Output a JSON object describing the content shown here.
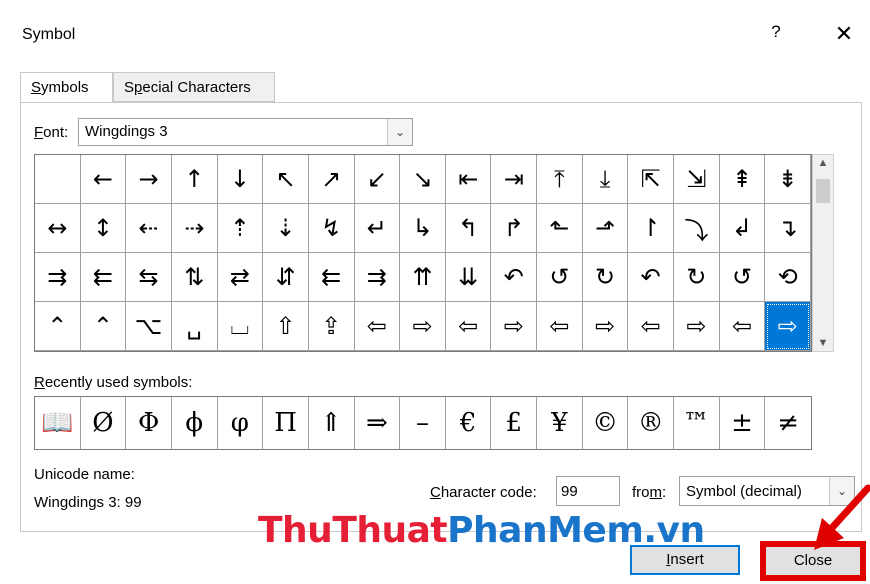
{
  "dialog": {
    "title": "Symbol",
    "help_label": "?",
    "close_glyph": "✕"
  },
  "tabs": [
    {
      "label_key": "S",
      "label_rest": "ymbols"
    },
    {
      "label_pre": "S",
      "label_key": "p",
      "label_rest": "ecial Characters"
    }
  ],
  "font": {
    "label_key": "F",
    "label_rest": "ont:",
    "value": "Wingdings 3"
  },
  "symbol_grid": [
    [
      "",
      "←",
      "→",
      "↑",
      "↓",
      "↖",
      "↗",
      "↙",
      "↘",
      "⇤",
      "⇥",
      "⤒",
      "⤓",
      "⇱",
      "⇲",
      "⇞",
      "⇟"
    ],
    [
      "↔",
      "↕",
      "⇠",
      "⇢",
      "⇡",
      "⇣",
      "↯",
      "↵",
      "↳",
      "↰",
      "↱",
      "⬑",
      "⬏",
      "↾",
      "⤵",
      "↲",
      "↴"
    ],
    [
      "⇉",
      "⇇",
      "⇆",
      "⇅",
      "⇄",
      "⇵",
      "⇇",
      "⇉",
      "⇈",
      "⇊",
      "↶",
      "↺",
      "↻",
      "↶",
      "↻",
      "↺",
      "⟲"
    ],
    [
      "⌃",
      "⌃",
      "⌥",
      "␣",
      "⌴",
      "⇧",
      "⇪",
      "⇦",
      "⇨",
      "⇦",
      "⇨",
      "⇦",
      "⇨",
      "⇦",
      "⇨",
      "⇦",
      "⇨"
    ]
  ],
  "selected_cell": {
    "row": 3,
    "col": 16
  },
  "recent": {
    "label_key": "R",
    "label_rest": "ecently used symbols:",
    "symbols": [
      "📖",
      "Ø",
      "Φ",
      "ϕ",
      "φ",
      "Π",
      "⇑",
      "⇒",
      "–",
      "€",
      "£",
      "¥",
      "©",
      "®",
      "™",
      "±",
      "≠"
    ]
  },
  "unicode": {
    "name_label": "Unicode name:",
    "name_value": "Wingdings 3: 99"
  },
  "char_code": {
    "label_key": "C",
    "label_rest": "haracter code:",
    "value": "99"
  },
  "from": {
    "label_pre": "fro",
    "label_key": "m",
    "label_rest": ":",
    "value": "Symbol (decimal)"
  },
  "buttons": {
    "insert_key": "I",
    "insert_rest": "nsert",
    "close_label": "Close"
  },
  "watermark": {
    "part1": "ThuThuat",
    "part2": "PhanMem",
    "part3": ".vn"
  },
  "colors": {
    "selection": "#0078d7",
    "annotation_red": "#e00000"
  }
}
